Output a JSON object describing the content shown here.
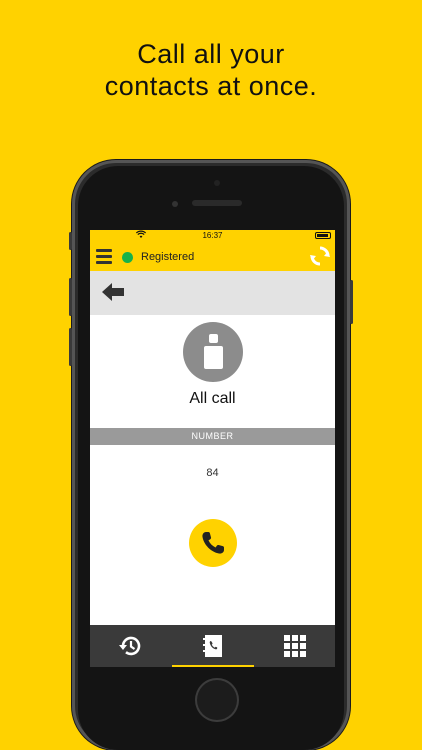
{
  "headline": {
    "line1": "Call all your",
    "line2": "contacts at once."
  },
  "status_bar": {
    "time": "16:37",
    "wifi_icon": "wifi-icon",
    "battery_icon": "battery-icon"
  },
  "app_bar": {
    "menu_icon": "hamburger-menu-icon",
    "registration_status": "Registered",
    "registration_color": "#16b24a",
    "sync_icon": "sync-icon"
  },
  "nav": {
    "back_icon": "arrow-left-icon"
  },
  "contact": {
    "name": "All call",
    "avatar_icon": "person-icon",
    "number_header": "NUMBER",
    "number": "84"
  },
  "actions": {
    "call_icon": "phone-icon"
  },
  "tabs": [
    {
      "name": "history",
      "icon": "history-icon",
      "active": false
    },
    {
      "name": "contacts",
      "icon": "contacts-book-icon",
      "active": true
    },
    {
      "name": "dialpad",
      "icon": "dialpad-icon",
      "active": false
    }
  ],
  "colors": {
    "accent": "#FFD200",
    "tabbar": "#3a3a3a",
    "header_gray": "#9a9a9a",
    "avatar_gray": "#8c8c8c"
  }
}
